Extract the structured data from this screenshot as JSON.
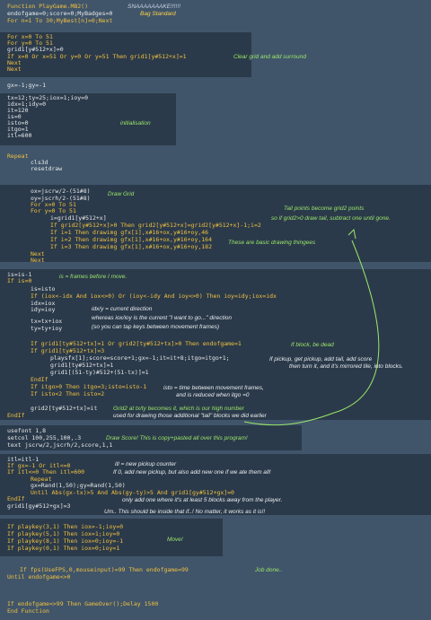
{
  "title_line": "Function PlayGame.MB2()",
  "title_comment": "SNAAAAAAAKE!!!!!!",
  "lines": {
    "l1": "endofgame=0;score=0;MyBadges=0",
    "l1c": "Bag Standard",
    "l2": "For n=1 To 30;MyBest[n]=0;Next",
    "l3": "For x=0 To 51",
    "l4": "For y=0 To 51",
    "l5": "grid1[y#512+x]=0",
    "l6": "If x=0 Or x=51 Or y=0 Or y=51 Then grid1[y#512+x]=1",
    "l6c": "Clear grid and add surround",
    "l7": "Next",
    "l8": "Next",
    "l9": "gx=-1;gy=-1",
    "l10": "tx=12;ty=25;iox=1;ioy=0",
    "l11": "idx=1;idy=0",
    "l12": "it=120",
    "l13": "is=0",
    "l13c": "initialisation",
    "l14": "isto=0",
    "l15": "itgo=1",
    "l16": "itl=600",
    "l17": "Repeat",
    "l18": "cls3d",
    "l19": "resetdraw",
    "l20": "ox=jscrw/2-(51#8)",
    "l20c": "Draw Grid",
    "l21": "oy=jscrh/2-(51#8)",
    "l22": "For x=0 To 51",
    "l23": "For y=0 To 51",
    "l24": "i=grid1[y#512+x]",
    "l24c": "Tail points become grid2 points",
    "l25": "If grid2[y#512+x]>0 Then grid2[y#512+x]=grid2[y#512+x]-1;i=2",
    "l25c": "so if grid2>0 draw tail, subtract one until gone.",
    "l26": "If i=1 Then drawimg gfx[1],x#16+ox,y#16+oy,46",
    "l27": "If i=2 Then drawimg gfx[1],x#16+ox,y#16+oy,164",
    "l27c": "These are basic drawing thingees",
    "l28": "If i=3 Then drawimg gfx[1],x#16+ox,y#16+oy,182",
    "l29": "Next",
    "l30": "Next",
    "l31": "is=is-1",
    "l31c": "is = frames before I move.",
    "l32": "If is=0",
    "l33": "is=isto",
    "l34": "If (iox<-idx And iox<>0) Or (ioy<-idy And ioy<>0) Then ioy=idy;iox=idx",
    "l35": "idx=iox",
    "l36": "idy=ioy",
    "l36c": "idx/y = current direction",
    "l37c": "whereas iox/ioy is the current \"I want to go...\" direction",
    "l38": "tx=tx+iox",
    "l38c": "(so you can tap keys between movement frames)",
    "l39": "ty=ty+ioy",
    "l40": "If grid1[ty#512+tx]=1 Or grid2[ty#512+tx]>0 Then endofgame=1",
    "l40c": "If block, be dead",
    "l41": "If grid1[ty#512+tx]=3",
    "l42": "playsfx[1];score=score+1;gx=-1;it=it+8;itgo=itgo+1;",
    "l42c": "If pickup, get pickup, add tail, add score",
    "l43": "grid1[ty#512+tx]=1",
    "l43c": "then turn it, and it's mirrored tile, into blocks.",
    "l44": "grid1[(51-ty)#512+(51-tx)]=1",
    "l45": "EndIf",
    "l46": "If itgo>0 Then itgo=3;isto=isto-1",
    "l46c": "isto = time between movement frames,",
    "l47": "If isto<2 Then isto=2",
    "l47c": "and is reduced when itgo =0",
    "l48": "grid2[ty#512+tx]=it",
    "l48c": "Grid2 at tx/ty becomes it, which is our high number",
    "l49": "EndIf",
    "l49c": "used for drawing those additional \"tail\" blocks we did earlier",
    "l50": "usefont 1,8",
    "l51": "setcol 100,255,100,.3",
    "l51c": "Draw Score!  This is copy+pasted all over this program!",
    "l52": "text jscrw/2,jscrh/2,score,1,1",
    "l53": "itl=itl-1",
    "l54": "If gx=-1 Or itl<=0",
    "l54c": "itl = new pickup counter",
    "l55": "If itl<=0 Then itl=600",
    "l55c": "If 0, add new pickup, but also add new one if we ate them all!",
    "l56": "Repeat",
    "l57": "gx=Rand(1,50);gy=Rand(1,50)",
    "l58": "Until Abs(gx-tx)>5 And Abs(gy-ty)>5 And grid1[gy#512+gx]=0",
    "l58c": "only add one where it's at least 5 blocks away from the player.",
    "l59": "EndIf",
    "l60": "grid1[gy#512+gx]=3",
    "l60c": "Um.. This should be inside that if..!  No matter, it works as it is!!",
    "l61": "If playkey(3,1) Then iox=-1;ioy=0",
    "l62": "If playkey(5,1) Then iox=1;ioy=0",
    "l63": "If playkey(8,1) Then iox=0;ioy=-1",
    "l63c": "Move!",
    "l64": "If playkey(0,1) Then iox=0;ioy=1",
    "l65": "If fps(UseFPS,0,mouseinput)=99 Then endofgame=99",
    "l65c": "Job done..",
    "l66": "Until endofgame<>0",
    "l67": "If endofgame<>99 Then GameOver();Delay 1500",
    "l68": "End Function"
  }
}
